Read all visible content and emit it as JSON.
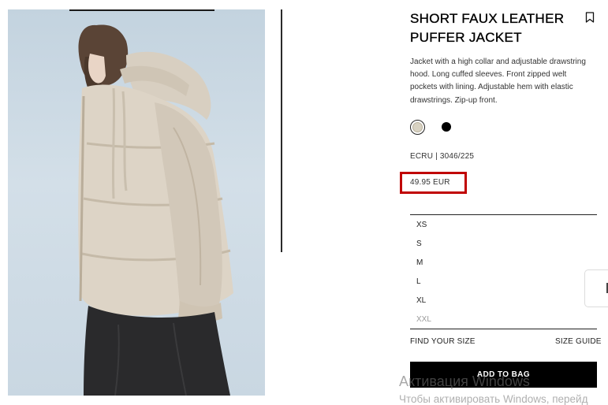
{
  "product": {
    "title_line1": "SHORT FAUX LEATHER",
    "title_line2": "PUFFER JACKET",
    "description": "Jacket with a high collar and adjustable drawstring hood. Long cuffed sleeves. Front zipped welt pockets with lining. Adjustable hem with elastic drawstrings. Zip-up front.",
    "colors": [
      {
        "name": "ecru",
        "hex": "#d8d2c2",
        "selected": true
      },
      {
        "name": "black",
        "hex": "#000000",
        "selected": false
      }
    ],
    "reference": "ECRU | 3046/225",
    "price": "49.95 EUR",
    "price_highlight_color": "#c00000"
  },
  "sizes": [
    {
      "label": "XS",
      "available": true
    },
    {
      "label": "S",
      "available": true
    },
    {
      "label": "M",
      "available": true
    },
    {
      "label": "L",
      "available": true
    },
    {
      "label": "XL",
      "available": true
    },
    {
      "label": "XXL",
      "available": false
    }
  ],
  "links": {
    "find_size": "FIND YOUR SIZE",
    "size_guide": "SIZE GUIDE"
  },
  "actions": {
    "add_to_bag": "ADD TO BAG"
  },
  "icons": {
    "bookmark": "bookmark-icon"
  },
  "watermark": {
    "title": "Активация Windows",
    "subtitle": "Чтобы активировать Windows, перейд"
  }
}
